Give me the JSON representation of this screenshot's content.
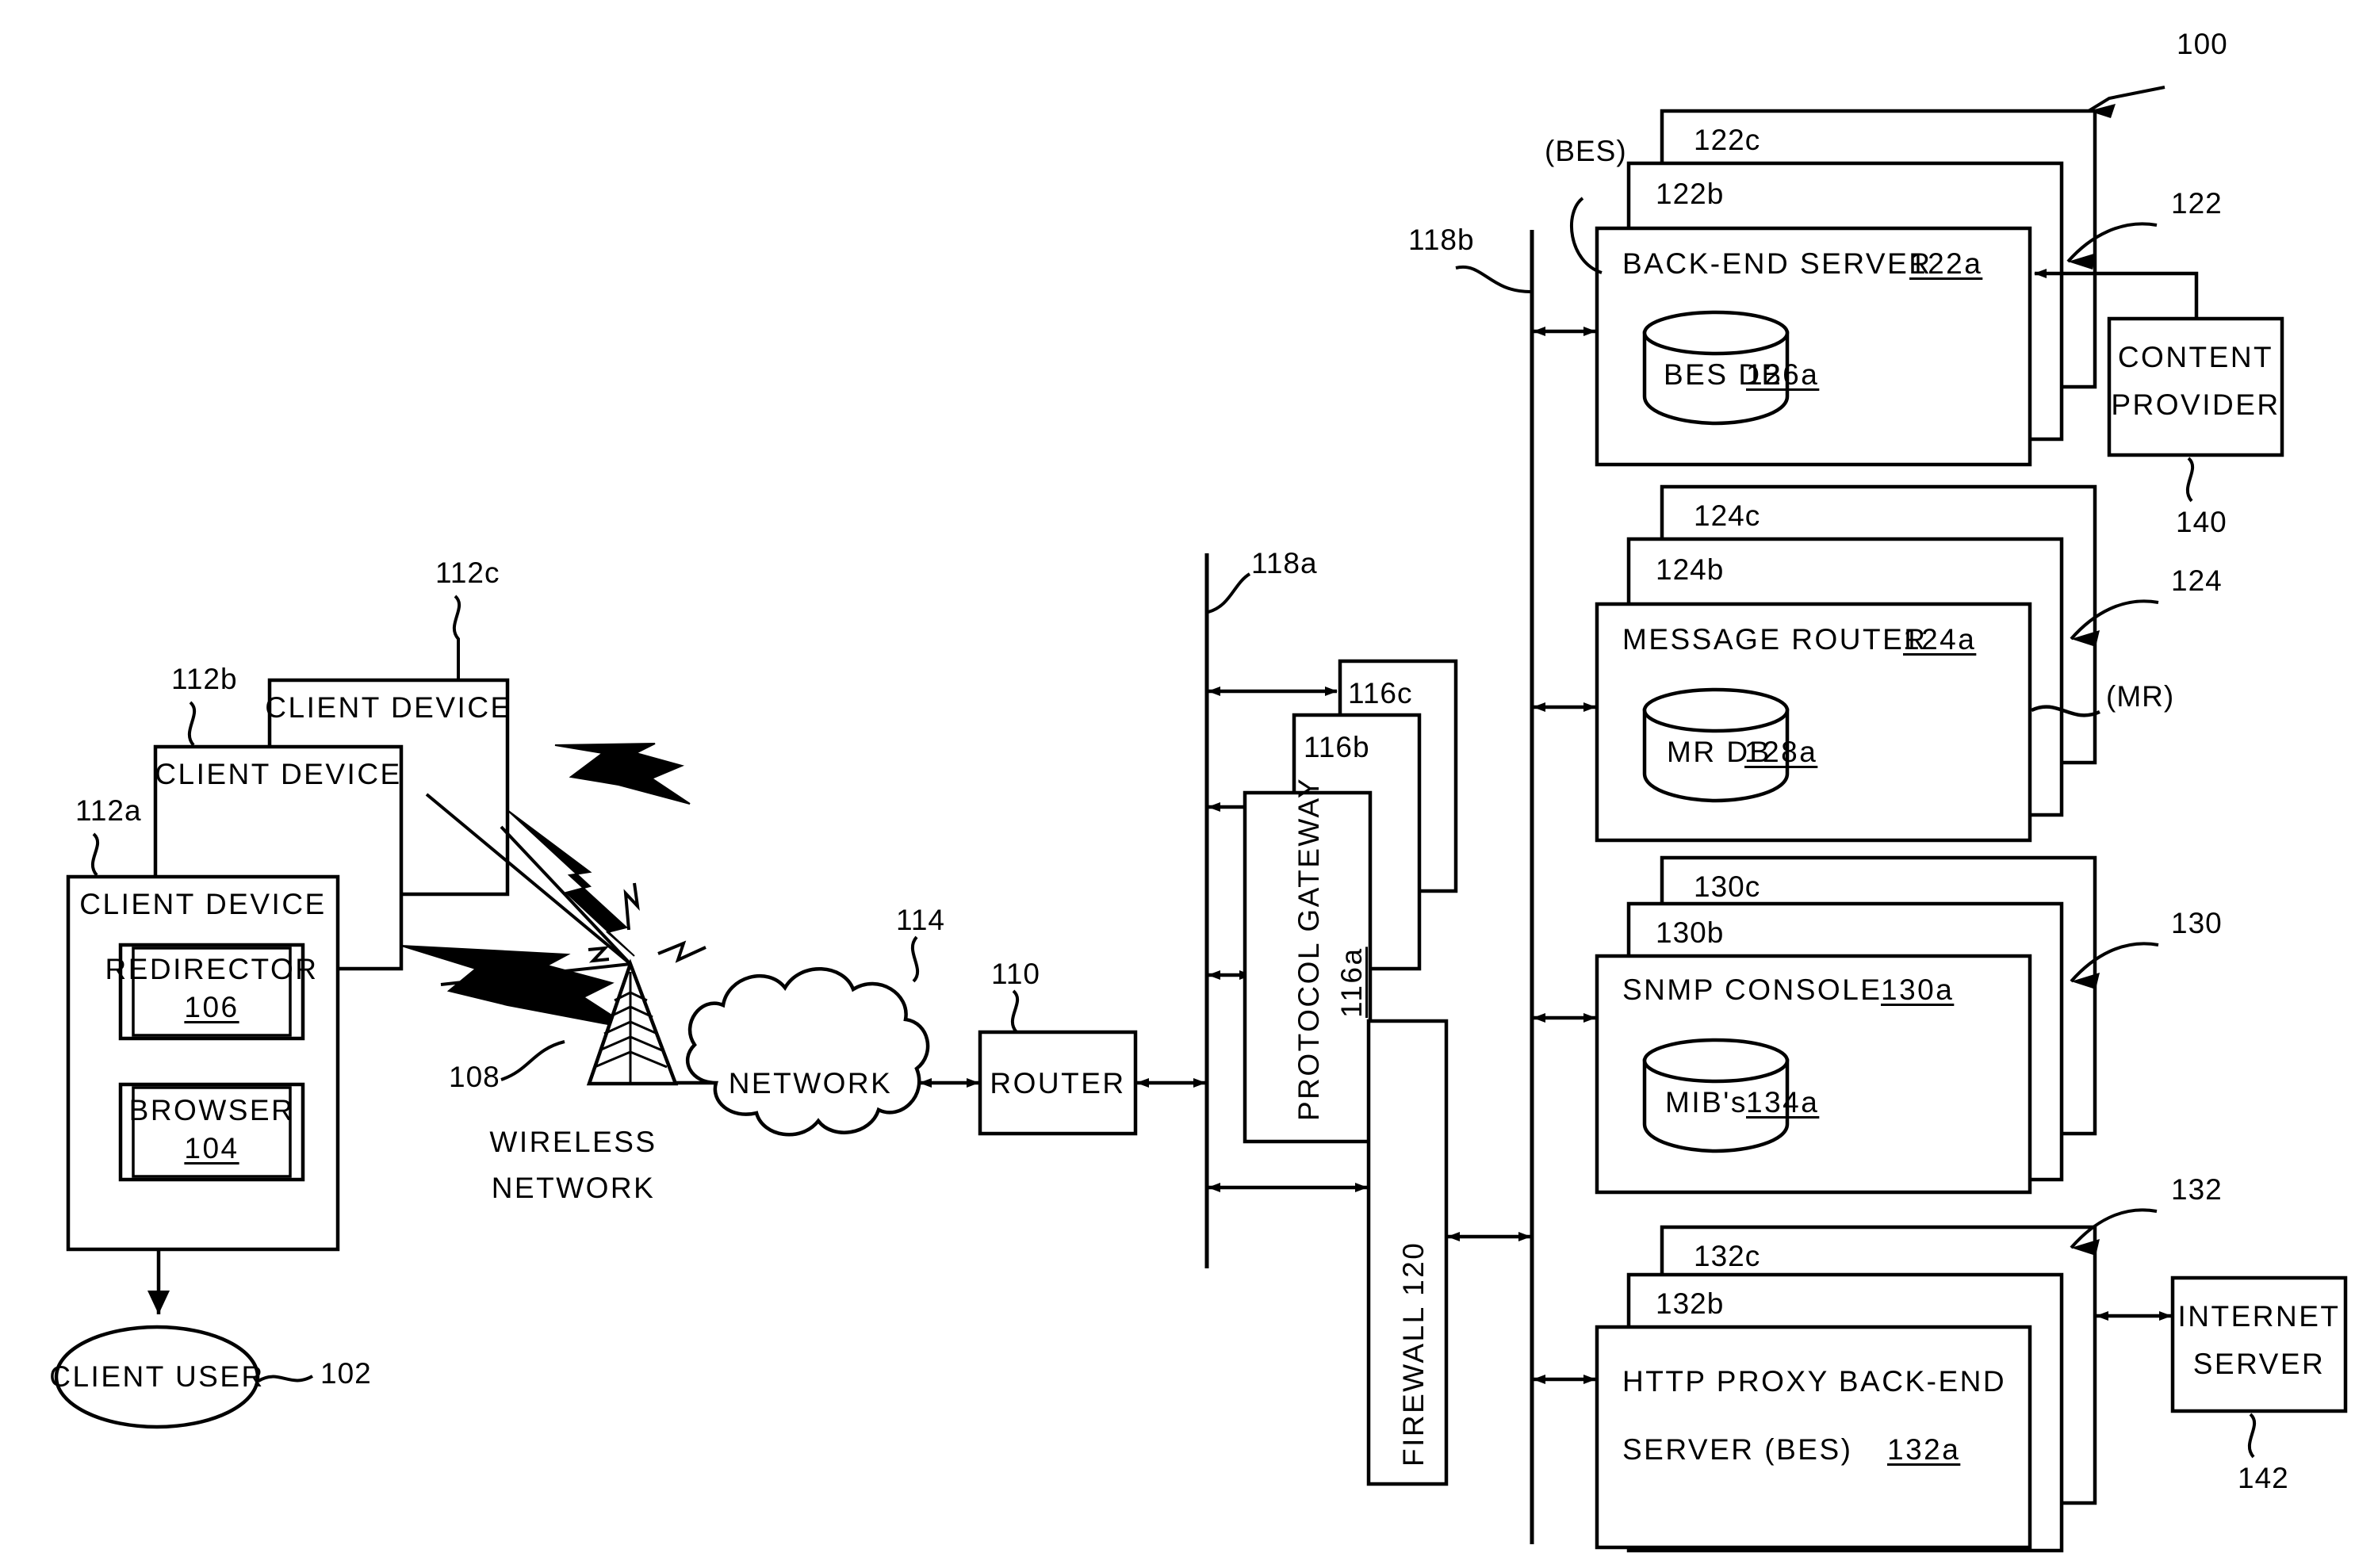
{
  "figure": {
    "system_ref": "100",
    "type": "patent-block-diagram"
  },
  "client_side": {
    "client_user": {
      "label": "CLIENT USER",
      "ref": "102"
    },
    "client_devices": {
      "stack_refs": [
        "112a",
        "112b",
        "112c"
      ],
      "label": "CLIENT DEVICE",
      "modules": [
        {
          "label": "REDIRECTOR",
          "ref": "106"
        },
        {
          "label": "BROWSER",
          "ref": "104"
        }
      ]
    },
    "wireless_network": {
      "label_line1": "WIRELESS",
      "label_line2": "NETWORK",
      "ref": "108"
    },
    "network_cloud": {
      "label": "NETWORK",
      "ref": "114"
    },
    "router": {
      "label": "ROUTER",
      "ref": "110"
    }
  },
  "middle": {
    "bus_a_ref": "118a",
    "protocol_gateway": {
      "label": "PROTOCOL GATEWAY",
      "ref": "116a",
      "stack_refs": [
        "116b",
        "116c"
      ]
    },
    "firewall": {
      "label": "FIREWALL 120",
      "ref": "120"
    }
  },
  "backend": {
    "bus_b_ref": "118b",
    "bes_tag": "(BES)",
    "mr_tag": "(MR)",
    "groups": [
      {
        "name": "back-end-server",
        "title": "BACK-END SERVER",
        "title_ref": "122a",
        "db_label": "BES DB",
        "db_ref": "126a",
        "group_ref": "122",
        "stack_refs": [
          "122b",
          "122c"
        ]
      },
      {
        "name": "message-router",
        "title": "MESSAGE ROUTER",
        "title_ref": "124a",
        "db_label": "MR DB",
        "db_ref": "128a",
        "group_ref": "124",
        "stack_refs": [
          "124b",
          "124c"
        ]
      },
      {
        "name": "snmp-console",
        "title": "SNMP CONSOLE",
        "title_ref": "130a",
        "db_label": "MIB's",
        "db_ref": "134a",
        "group_ref": "130",
        "stack_refs": [
          "130b",
          "130c"
        ]
      },
      {
        "name": "http-proxy-bes",
        "title_line1": "HTTP PROXY BACK-END",
        "title_line2": "SERVER (BES)",
        "title_ref": "132a",
        "group_ref": "132",
        "stack_refs": [
          "132b",
          "132c"
        ]
      }
    ],
    "content_provider": {
      "line1": "CONTENT",
      "line2": "PROVIDER",
      "ref": "140"
    },
    "internet_server": {
      "line1": "INTERNET",
      "line2": "SERVER",
      "ref": "142"
    }
  },
  "colors": {
    "ink": "#000000",
    "paper": "#ffffff"
  }
}
